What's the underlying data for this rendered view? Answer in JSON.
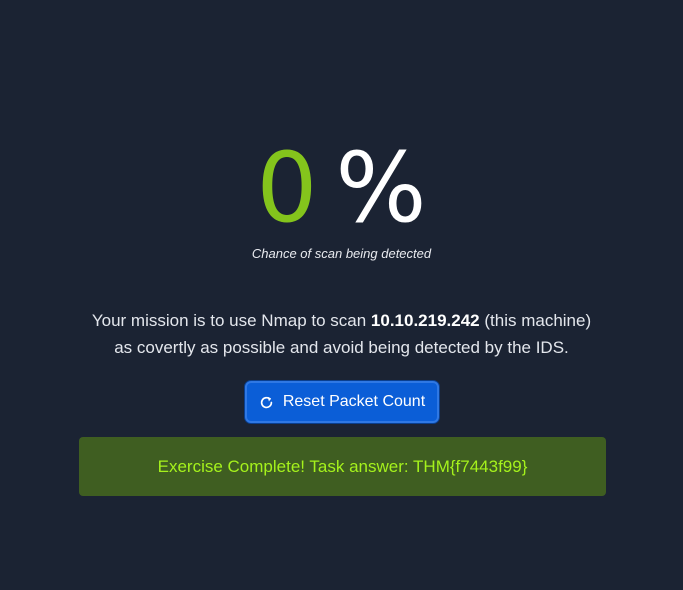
{
  "detection": {
    "value": "0",
    "unit": "%",
    "caption": "Chance of scan being detected"
  },
  "mission": {
    "line1_prefix": "Your mission is to use Nmap to scan ",
    "target_ip": "10.10.219.242",
    "line1_suffix": " (this machine)",
    "line2": "as covertly as possible and avoid being detected by the IDS."
  },
  "reset_button": {
    "label": "Reset Packet Count",
    "icon": "refresh-icon"
  },
  "result": {
    "message": "Exercise Complete! Task answer: THM{f7443f99}"
  },
  "colors": {
    "background": "#1b2333",
    "value_accent": "#84c41c",
    "button_blue": "#0b5ed7",
    "success_bg": "#3f5e21",
    "success_text": "#a5f21c"
  }
}
